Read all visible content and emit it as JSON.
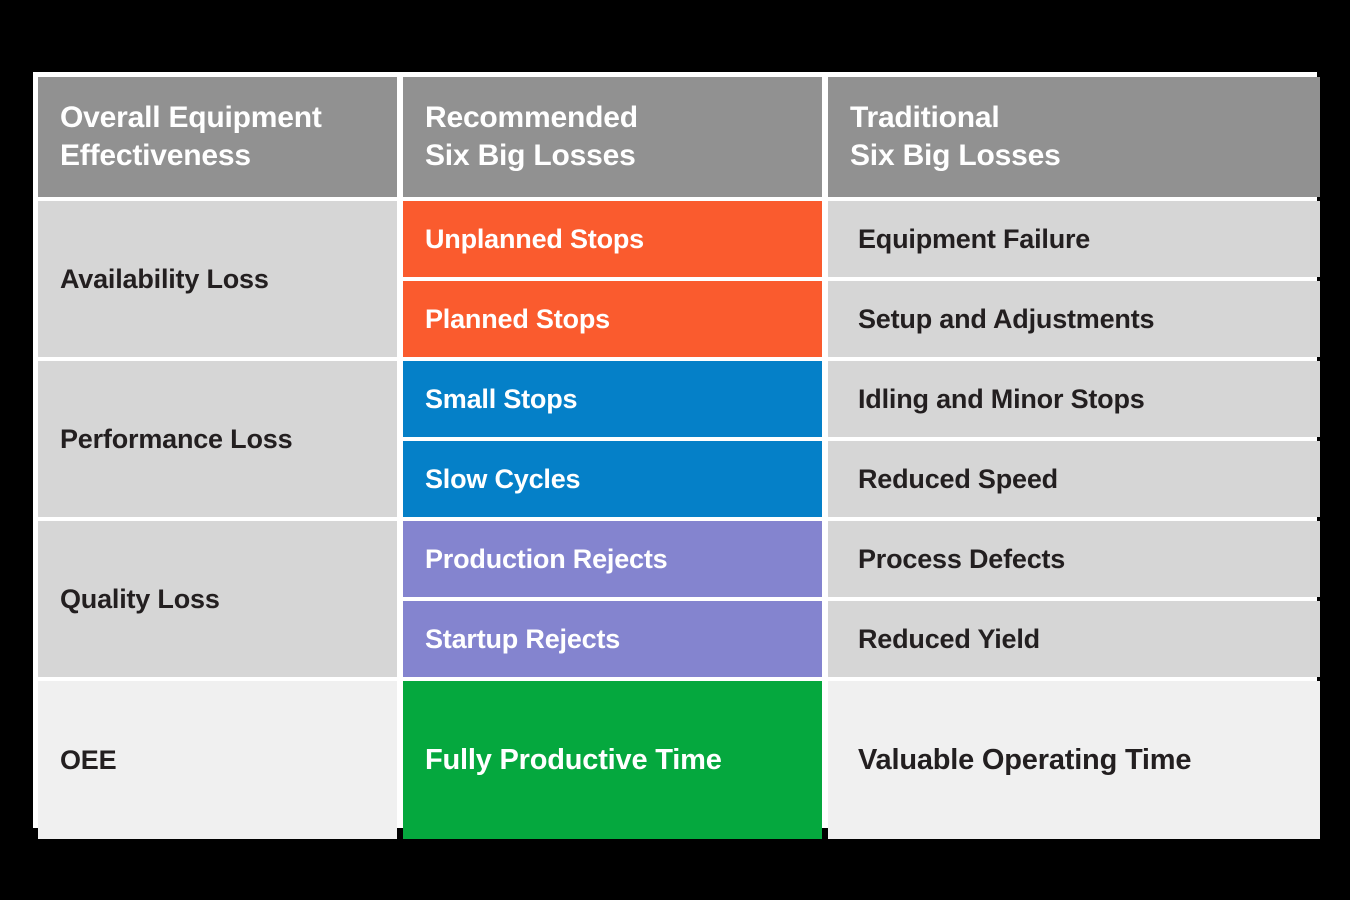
{
  "card": {
    "background_color": "#ffffff",
    "page_background_color": "#000000"
  },
  "palette": {
    "header_gray": "#919191",
    "row_gray": "#d6d6d6",
    "summary_gray": "#f0f0f0",
    "availability_orange": "#fa5b2e",
    "performance_blue": "#0580c8",
    "quality_purple": "#8484cf",
    "oee_green": "#05a83e",
    "text_dark": "#231f20",
    "text_light": "#ffffff"
  },
  "table": {
    "headers": [
      {
        "line1": "Overall Equipment",
        "line2": "Effectiveness"
      },
      {
        "line1": "Recommended",
        "line2": "Six Big Losses"
      },
      {
        "line1": "Traditional",
        "line2": "Six Big Losses"
      }
    ],
    "groups": [
      {
        "category": "Availability Loss",
        "accent": "#fa5b2e",
        "rows": [
          {
            "recommended": "Unplanned Stops",
            "traditional": "Equipment Failure"
          },
          {
            "recommended": "Planned Stops",
            "traditional": "Setup and Adjustments"
          }
        ]
      },
      {
        "category": "Performance Loss",
        "accent": "#0580c8",
        "rows": [
          {
            "recommended": "Small Stops",
            "traditional": "Idling and Minor Stops"
          },
          {
            "recommended": "Slow Cycles",
            "traditional": "Reduced Speed"
          }
        ]
      },
      {
        "category": "Quality Loss",
        "accent": "#8484cf",
        "rows": [
          {
            "recommended": "Production Rejects",
            "traditional": "Process Defects"
          },
          {
            "recommended": "Startup Rejects",
            "traditional": "Reduced Yield"
          }
        ]
      }
    ],
    "summary": {
      "category": "OEE",
      "accent": "#05a83e",
      "recommended": "Fully Productive Time",
      "traditional": "Valuable Operating Time"
    }
  }
}
